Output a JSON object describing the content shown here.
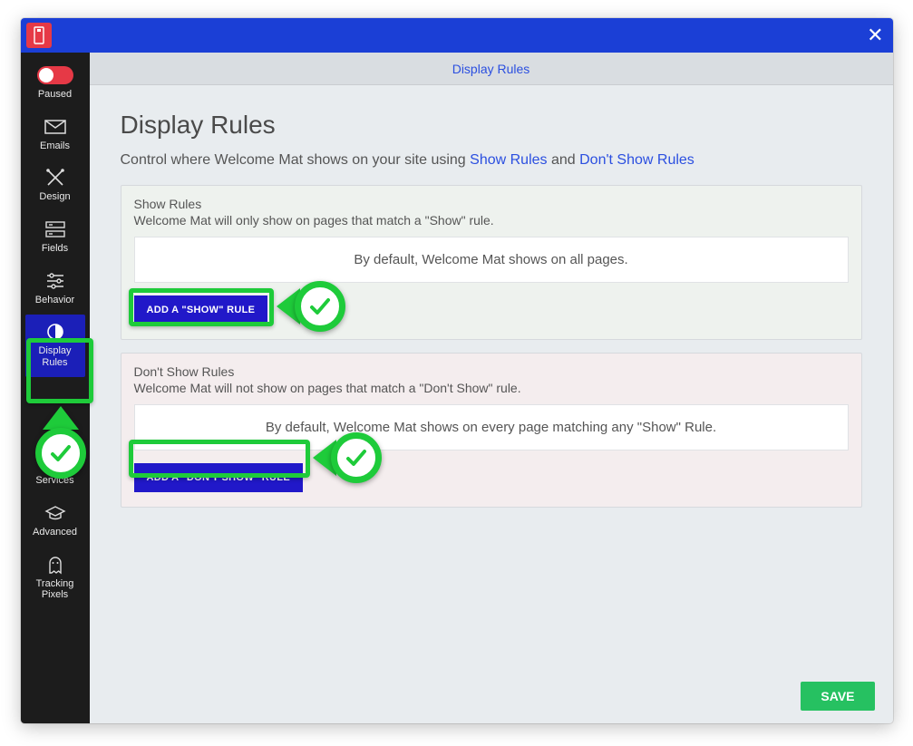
{
  "titlebar": {
    "close_glyph": "✕"
  },
  "sidebar": {
    "status_label": "Paused",
    "items": [
      {
        "label": "Emails"
      },
      {
        "label": "Design"
      },
      {
        "label": "Fields"
      },
      {
        "label": "Behavior"
      },
      {
        "label": "Display\nRules",
        "active": true
      },
      {
        "label": "Services"
      },
      {
        "label": "Advanced"
      },
      {
        "label": "Tracking\nPixels"
      }
    ]
  },
  "tabbar": {
    "title": "Display Rules"
  },
  "page": {
    "title": "Display Rules",
    "subtitle_prefix": "Control where Welcome Mat shows on your site using ",
    "link_show": "Show Rules",
    "subtitle_and": " and ",
    "link_dont": "Don't Show Rules"
  },
  "show_panel": {
    "title": "Show Rules",
    "desc": "Welcome Mat will only show on pages that match a \"Show\" rule.",
    "box": "By default, Welcome Mat shows on all pages.",
    "button": "ADD A \"SHOW\" RULE"
  },
  "dont_panel": {
    "title": "Don't Show Rules",
    "desc": "Welcome Mat will not show on pages that match a \"Don't Show\" rule.",
    "box": "By default, Welcome Mat shows on every page matching any \"Show\" Rule.",
    "button": "ADD A \"DON'T SHOW\" RULE"
  },
  "footer": {
    "save": "SAVE"
  }
}
